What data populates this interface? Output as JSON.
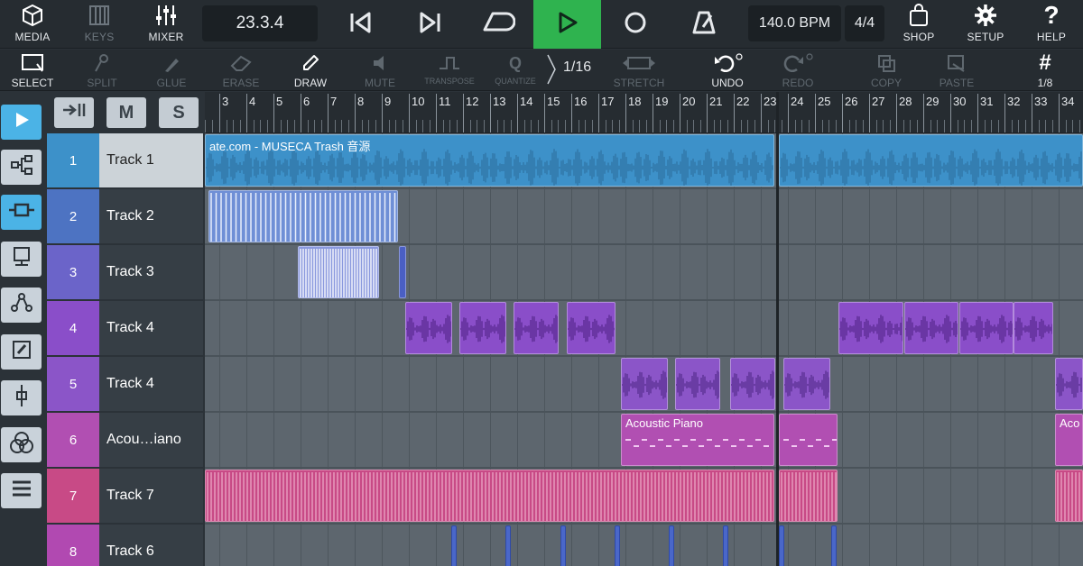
{
  "colors": {
    "accent": "#4bb3e6",
    "play": "#2fb34f",
    "track1": "#3d91c9",
    "track2": "#4d73c2",
    "track3": "#6b64c9",
    "track4": "#8a4ec9",
    "track5": "#8b55c8",
    "track6": "#b14fb2",
    "track7": "#c84a86",
    "track8": "#b149b1"
  },
  "topbar": {
    "media": "MEDIA",
    "keys": "KEYS",
    "mixer": "MIXER",
    "position": "23.3.4",
    "tempo": "140.0 BPM",
    "time_signature": "4/4",
    "shop": "SHOP",
    "setup": "SETUP",
    "help": "HELP"
  },
  "toolbar": {
    "select": "SELECT",
    "split": "SPLIT",
    "glue": "GLUE",
    "erase": "ERASE",
    "draw": "DRAW",
    "mute": "MUTE",
    "transpose": "TRANSPOSE",
    "quantize": "QUANTIZE",
    "snap": "1/16",
    "stretch": "STRETCH",
    "undo": "UNDO",
    "redo": "REDO",
    "copy": "COPY",
    "paste": "PASTE",
    "grid": "1/8"
  },
  "header_buttons": {
    "mute": "M",
    "solo": "S"
  },
  "tracks": [
    {
      "num": "1",
      "name": "Track 1"
    },
    {
      "num": "2",
      "name": "Track 2"
    },
    {
      "num": "3",
      "name": "Track 3"
    },
    {
      "num": "4",
      "name": "Track 4"
    },
    {
      "num": "5",
      "name": "Track 4"
    },
    {
      "num": "6",
      "name": "Acou…iano"
    },
    {
      "num": "7",
      "name": "Track 7"
    },
    {
      "num": "8",
      "name": "Track 6"
    }
  ],
  "ruler": {
    "bars": [
      "3",
      "4",
      "5",
      "6",
      "7",
      "8",
      "9",
      "10",
      "11",
      "12",
      "13",
      "14",
      "15",
      "16",
      "17",
      "18",
      "19",
      "20",
      "21",
      "22",
      "23",
      "24",
      "25",
      "26",
      "27",
      "28",
      "29",
      "30",
      "31",
      "32",
      "33",
      "34"
    ]
  },
  "clips": {
    "audio_title": "ate.com - MUSECA Trash 音源",
    "piano_title": "Acoustic Piano",
    "piano_title_cut": "Aco"
  }
}
